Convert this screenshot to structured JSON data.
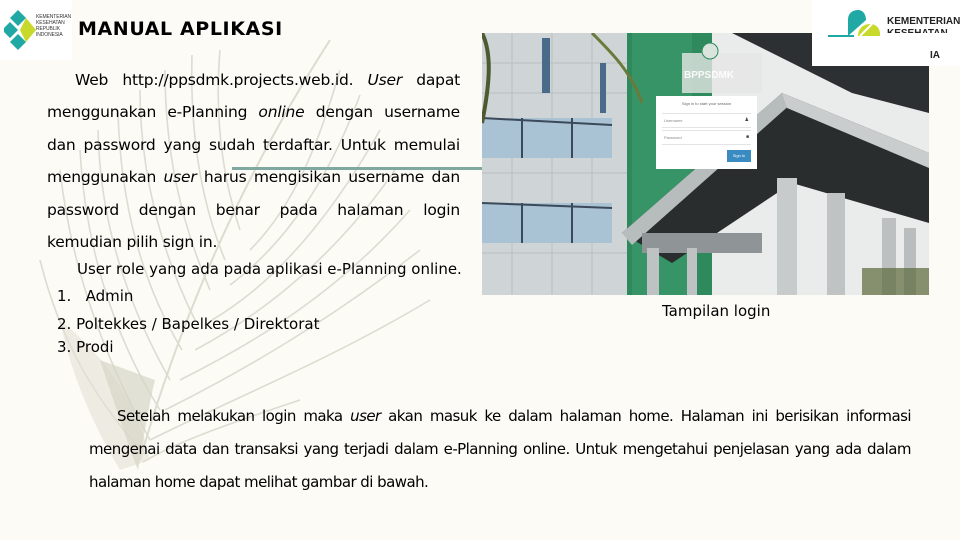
{
  "header": {
    "title": "MANUAL APLIKASI",
    "logo_left": {
      "icon": "kemenkes-logo-icon",
      "lines": [
        "KEMENTERIAN",
        "KESEHATAN",
        "REPUBLIK",
        "INDONESIA"
      ]
    },
    "logo_right": {
      "icon": "kemenkes-new-logo-icon",
      "line1": "KEMENTERIAN",
      "line2": "KESEHATAN",
      "line3": "IA"
    }
  },
  "intro": {
    "p1": "Web http://ppsdmk.projects.web.id. ",
    "p1_em": "User",
    "p2": " dapat menggunakan e-Planning ",
    "p2_em": "online",
    "p3": " dengan username dan password yang sudah terdaftar. Untuk memulai menggunakan ",
    "p3_em": "user",
    "p4": " harus mengisikan username dan password dengan benar pada halaman login kemudian pilih sign in."
  },
  "roles": {
    "heading": "User role yang ada pada aplikasi e-Planning online.",
    "items": [
      "1.   Admin",
      "2. Poltekkes / Bapelkes / Direktorat",
      "3. Prodi"
    ]
  },
  "screenshot": {
    "brand": "BPPSDMK",
    "login": {
      "heading": "Sign in to start your session",
      "username_placeholder": "Username",
      "password_placeholder": "Password",
      "sign_in_label": "Sign In",
      "user_icon": "user-icon",
      "lock_icon": "lock-icon"
    },
    "caption": "Tampilan login"
  },
  "home": {
    "p1": "Setelah melakukan login maka ",
    "p1_em": "user",
    "p2": " akan masuk ke dalam halaman home. Halaman ini berisikan informasi mengenai data dan transaksi yang terjadi dalam e-Planning online. Untuk mengetahui penjelasan yang ada dalam halaman home dapat melihat gambar di bawah."
  },
  "colors": {
    "background": "#fcfbf6",
    "accent_teal": "#7fa8a0",
    "logo_teal": "#1fa8a4",
    "logo_lime": "#c7d92a",
    "button_blue": "#3a8bc1",
    "building_green": "#2e8a5c"
  }
}
